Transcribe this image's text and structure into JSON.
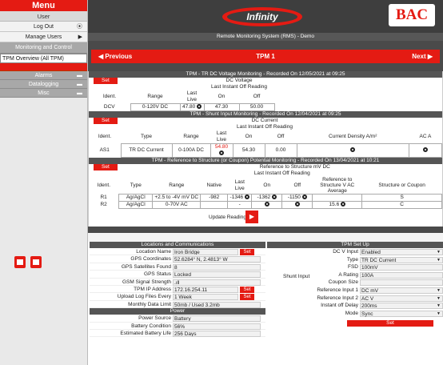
{
  "sidebar": {
    "menu_title": "Menu",
    "user_label": "User",
    "logout": "Log Out",
    "manage_users": "Manage Users",
    "monitoring": "Monitoring and Control",
    "tpm_overview": "TPM Overview (All TPM)",
    "alarms": "Alarms",
    "datalogging": "Datalogging",
    "misc": "Misc"
  },
  "header": {
    "logo": "Infinity",
    "brand": "BAC",
    "subtitle": "Remote Monitoring System (RMS) - Demo"
  },
  "nav": {
    "prev": "Previous",
    "title": "TPM 1",
    "next": "Next"
  },
  "dcv": {
    "title": "TPM - TR DC Voltage Monitoring - Recorded On 12/05/2021 at 09:25",
    "set": "Set",
    "group": "DC Voltage",
    "h_ident": "Ident.",
    "h_range": "Range",
    "h_last_live": "Last Live",
    "h_lio": "Last Instant Off Reading",
    "h_on": "On",
    "h_off": "Off",
    "row": {
      "ident": "DCV",
      "range": "0-120V DC",
      "last": "47.80",
      "on": "47.30",
      "off": "50.00"
    }
  },
  "shunt": {
    "title": "TPM - Shunt Input Monitoring - Recorded On 12/04/2021 at 09:25",
    "set": "Set",
    "group": "DC Current",
    "h_ident": "Ident.",
    "h_type": "Type",
    "h_range": "Range",
    "h_last_live": "Last Live",
    "h_lio": "Last Instant Off Reading",
    "h_on": "On",
    "h_off": "Off",
    "h_density": "Current Density A/m²",
    "h_aca": "AC A",
    "row": {
      "ident": "AS1",
      "type": "TR DC Current",
      "range": "0-100A DC",
      "last": "54.80",
      "on": "54.30",
      "off": "0.00"
    }
  },
  "ref": {
    "title": "TPM - Reference to Structure (or Coupon) Potential Monitoring - Recorded On 13/04/2021 at 10:21",
    "set": "Set",
    "group": "Reference to Structure mV DC",
    "h_ident": "Ident.",
    "h_type": "Type",
    "h_range": "Range",
    "h_native": "Native",
    "h_last_live": "Last Live",
    "h_lio": "Last Instant Off Reading",
    "h_on": "On",
    "h_off": "Off",
    "h_avg": "Reference to Structure V AC Average",
    "h_sc": "Structure or Coupon",
    "rows": [
      {
        "ident": "R1",
        "type": "Ag/AgCl",
        "range": "+2.5 to -4V mV DC",
        "native": "-982",
        "last": "-1346",
        "on": "-1362",
        "off": "-1150",
        "avg": "",
        "sc": "S"
      },
      {
        "ident": "R2",
        "type": "Ag/AgCl",
        "range": "0-70V AC",
        "native": "",
        "last": "-",
        "on": "",
        "off": "",
        "avg": "15.6",
        "sc": "C"
      }
    ]
  },
  "update": {
    "label": "Update Readings"
  },
  "loc": {
    "title": "Locations and Communications",
    "rows": [
      {
        "label": "Location Name",
        "value": "Iron Bridge",
        "set": "Set"
      },
      {
        "label": "GPS Coordinates",
        "value": "52.6284° N, 2.4813° W"
      },
      {
        "label": "GPS Satellites Found",
        "value": "8"
      },
      {
        "label": "GPS Status",
        "value": "Locked"
      },
      {
        "label": "GSM Signal Strength",
        "value": ".ıll"
      },
      {
        "label": "TPM IP Address",
        "value": "172.16.254.11",
        "set": "Set"
      },
      {
        "label": "Upload Log Files Every",
        "value": "1 Week",
        "set": "Set"
      },
      {
        "label": "Monthly Data Limit",
        "value": "50mb / Used 3.2mb"
      }
    ]
  },
  "power": {
    "title": "Power",
    "rows": [
      {
        "label": "Power Source",
        "value": "Battery"
      },
      {
        "label": "Battery Condition",
        "value": "56%"
      },
      {
        "label": "Estimated Battery Life",
        "value": "256 Days"
      }
    ]
  },
  "setup": {
    "title": "TPM Set Up",
    "shunt_label": "Shunt Input",
    "set": "Set",
    "rows": [
      {
        "label": "DC V Input",
        "value": "Enabled",
        "caret": true
      },
      {
        "label": "Type",
        "value": "TR DC Current",
        "caret": true
      },
      {
        "label": "FSD",
        "value": "100mV"
      },
      {
        "label": "A Rating",
        "value": "100A"
      },
      {
        "label": "Coupon Size",
        "value": ""
      },
      {
        "label": "Reference Input 1",
        "value": "DC mV",
        "caret": true
      },
      {
        "label": "Reference Input 2",
        "value": "AC V",
        "caret": true
      },
      {
        "label": "Instant off Delay",
        "value": "200ms",
        "caret": true
      },
      {
        "label": "Mode",
        "value": "Sync",
        "caret": true
      }
    ]
  }
}
